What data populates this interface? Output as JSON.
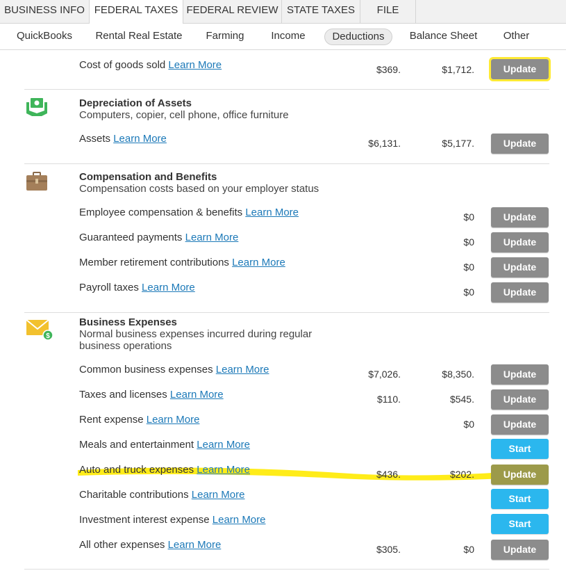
{
  "top_tabs": [
    {
      "label": "BUSINESS INFO"
    },
    {
      "label": "FEDERAL TAXES"
    },
    {
      "label": "FEDERAL REVIEW"
    },
    {
      "label": "STATE TAXES"
    },
    {
      "label": "FILE"
    }
  ],
  "sub_tabs": [
    {
      "label": "QuickBooks"
    },
    {
      "label": "Rental Real Estate"
    },
    {
      "label": "Farming"
    },
    {
      "label": "Income"
    },
    {
      "label": "Deductions"
    },
    {
      "label": "Balance Sheet"
    },
    {
      "label": "Other"
    }
  ],
  "learn_more": "Learn More",
  "sections": {
    "cogs": {
      "rows": [
        {
          "label": "Cost of goods sold",
          "amt1": "$369.",
          "amt2": "$1,712.",
          "button": "Update"
        }
      ]
    },
    "depreciation": {
      "title": "Depreciation of Assets",
      "desc": "Computers, copier, cell phone, office furniture",
      "rows": [
        {
          "label": "Assets",
          "amt1": "$6,131.",
          "amt2": "$5,177.",
          "button": "Update"
        }
      ]
    },
    "compensation": {
      "title": "Compensation and Benefits",
      "desc": "Compensation costs based on your employer status",
      "rows": [
        {
          "label": "Employee compensation & benefits",
          "amt2": "$0",
          "button": "Update"
        },
        {
          "label": "Guaranteed payments",
          "amt2": "$0",
          "button": "Update"
        },
        {
          "label": "Member retirement contributions",
          "amt2": "$0",
          "button": "Update"
        },
        {
          "label": "Payroll taxes",
          "amt2": "$0",
          "button": "Update"
        }
      ]
    },
    "business": {
      "title": "Business Expenses",
      "desc_line1": "Normal business expenses incurred during regular",
      "desc_line2": "business operations",
      "rows": [
        {
          "label": "Common business expenses",
          "amt1": "$7,026.",
          "amt2": "$8,350.",
          "button": "Update"
        },
        {
          "label": "Taxes and licenses",
          "amt1": "$110.",
          "amt2": "$545.",
          "button": "Update"
        },
        {
          "label": "Rent expense",
          "amt2": "$0",
          "button": "Update"
        },
        {
          "label": "Meals and entertainment",
          "button": "Start"
        },
        {
          "label": "Auto and truck expenses",
          "amt1": "$436.",
          "amt2": "$202.",
          "button": "Update"
        },
        {
          "label": "Charitable contributions",
          "button": "Start"
        },
        {
          "label": "Investment interest expense",
          "button": "Start"
        },
        {
          "label": "All other expenses",
          "amt1": "$305.",
          "amt2": "$0",
          "button": "Update"
        }
      ]
    }
  },
  "colors": {
    "link": "#1c79b8",
    "update_button": "#8c8c8c",
    "start_button": "#2bb7ee",
    "highlight": "#ffea00"
  }
}
